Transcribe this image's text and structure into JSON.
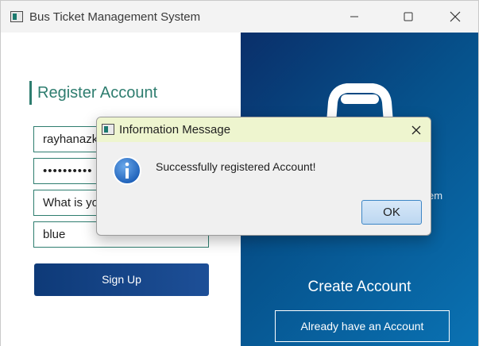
{
  "window": {
    "title": "Bus Ticket Management System",
    "controls": {
      "minimize_icon": "minimize-icon",
      "maximize_icon": "maximize-icon",
      "close_icon": "close-icon"
    }
  },
  "register": {
    "title": "Register Account",
    "fields": {
      "username": "rayhanazky",
      "password_mask": "••••••••••",
      "security_question": "What is yo",
      "security_answer": "blue"
    },
    "signup_label": "Sign Up"
  },
  "side_panel": {
    "icon": "bus-icon",
    "subtitle_fragment": "em",
    "heading": "Create Account",
    "have_account_label": "Already have an Account"
  },
  "dialog": {
    "title": "Information Message",
    "message": "Successfully registered Account!",
    "ok_label": "OK",
    "icon": "info-icon"
  },
  "colors": {
    "accent_teal": "#2e7d6f",
    "button_navy": "#0e3a78",
    "panel_blue": "#06528c",
    "dialog_title_bg": "#eef5cf"
  }
}
